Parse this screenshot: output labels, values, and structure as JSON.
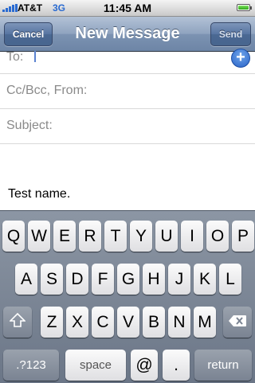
{
  "status_bar": {
    "carrier": "AT&T",
    "network": "3G",
    "time": "11:45 AM",
    "battery_level": 1.0
  },
  "nav": {
    "cancel_label": "Cancel",
    "title": "New Message",
    "send_label": "Send"
  },
  "compose": {
    "to_label": "To:",
    "cc_label": "Cc/Bcc, From:",
    "subject_label": "Subject:",
    "body": "Test name."
  },
  "keyboard": {
    "row1": [
      "Q",
      "W",
      "E",
      "R",
      "T",
      "Y",
      "U",
      "I",
      "O",
      "P"
    ],
    "row2": [
      "A",
      "S",
      "D",
      "F",
      "G",
      "H",
      "J",
      "K",
      "L"
    ],
    "row3": [
      "Z",
      "X",
      "C",
      "V",
      "B",
      "N",
      "M"
    ],
    "numbers_label": ".?123",
    "space_label": "space",
    "at_label": "@",
    "dot_label": ".",
    "return_label": "return",
    "shift_icon": "shift-icon",
    "backspace_icon": "backspace-icon"
  },
  "colors": {
    "nav_blue": "#6d85a6",
    "signal_blue": "#2a6bd1",
    "cursor_blue": "#5b83d1"
  }
}
